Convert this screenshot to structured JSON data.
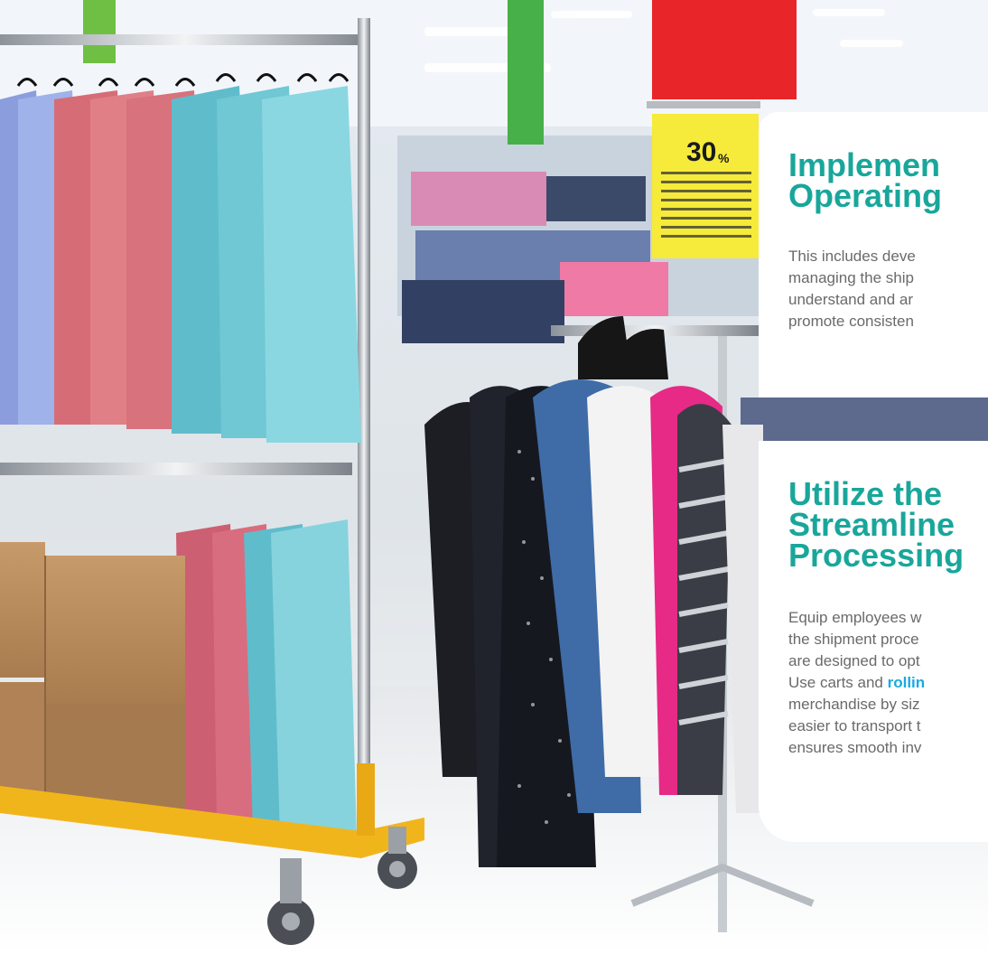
{
  "photo": {
    "subject": "clothing-rack-store-scene",
    "sign_percent": "30",
    "sign_unit": "%"
  },
  "card1": {
    "title_line1": "Implemen",
    "title_line2": "Operating",
    "body_lines": [
      "This includes deve",
      "managing the ship",
      "understand and ar",
      "promote consisten"
    ]
  },
  "card2": {
    "title_line1": "Utilize the",
    "title_line2": "Streamline",
    "title_line3": "Processing",
    "body_lines": [
      "Equip employees w",
      "the shipment proce",
      "are designed to opt"
    ],
    "line4_before": "Use carts and ",
    "line4_link": "rollin",
    "body_lines_after": [
      "merchandise by siz",
      "easier to transport t",
      "ensures smooth inv"
    ]
  },
  "colors": {
    "accent": "#19a69b",
    "link": "#1aa9e3",
    "text": "#6a6a6a",
    "card": "#ffffff",
    "sign": "#f6ea3a",
    "banner": "#e8262a"
  }
}
